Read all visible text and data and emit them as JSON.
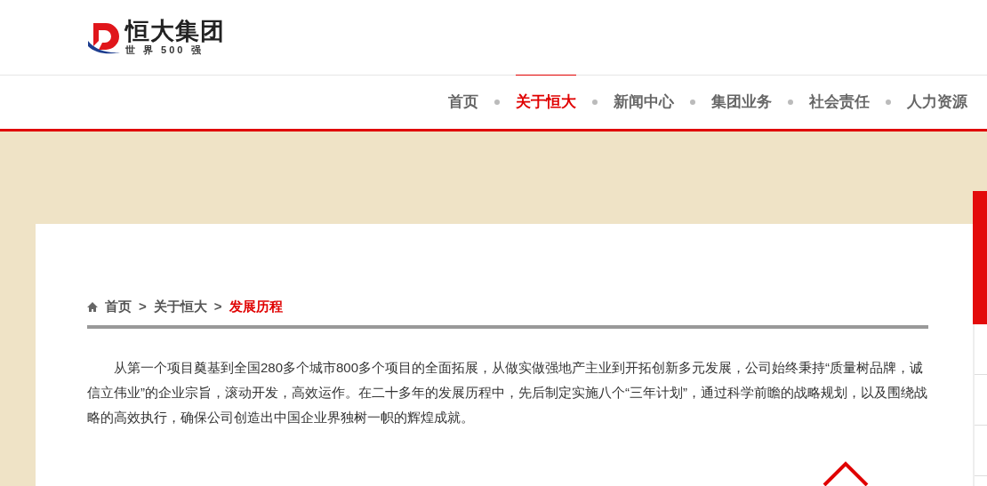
{
  "logo": {
    "name": "恒大集团",
    "tagline": "世 界 500 强"
  },
  "nav": [
    {
      "label": "首页",
      "selected": false
    },
    {
      "label": "关于恒大",
      "selected": true
    },
    {
      "label": "新闻中心",
      "selected": false
    },
    {
      "label": "集团业务",
      "selected": false
    },
    {
      "label": "社会责任",
      "selected": false
    },
    {
      "label": "人力资源",
      "selected": false
    }
  ],
  "breadcrumb": [
    {
      "label": "首页",
      "current": false
    },
    {
      "label": "关于恒大",
      "current": false
    },
    {
      "label": "发展历程",
      "current": true
    }
  ],
  "breadcrumb_separator": ">",
  "intro": "从第一个项目奠基到全国280多个城市800多个项目的全面拓展，从做实做强地产主业到开拓创新多元发展，公司始终秉持“质量树品牌，诚信立伟业”的企业宗旨，滚动开发，高效运作。在二十多年的发展历程中，先后制定实施八个“三年计划”，通过科学前瞻的战略规划，以及围绕战略的高效执行，确保公司创造出中国企业界独树一帜的辉煌成就。"
}
